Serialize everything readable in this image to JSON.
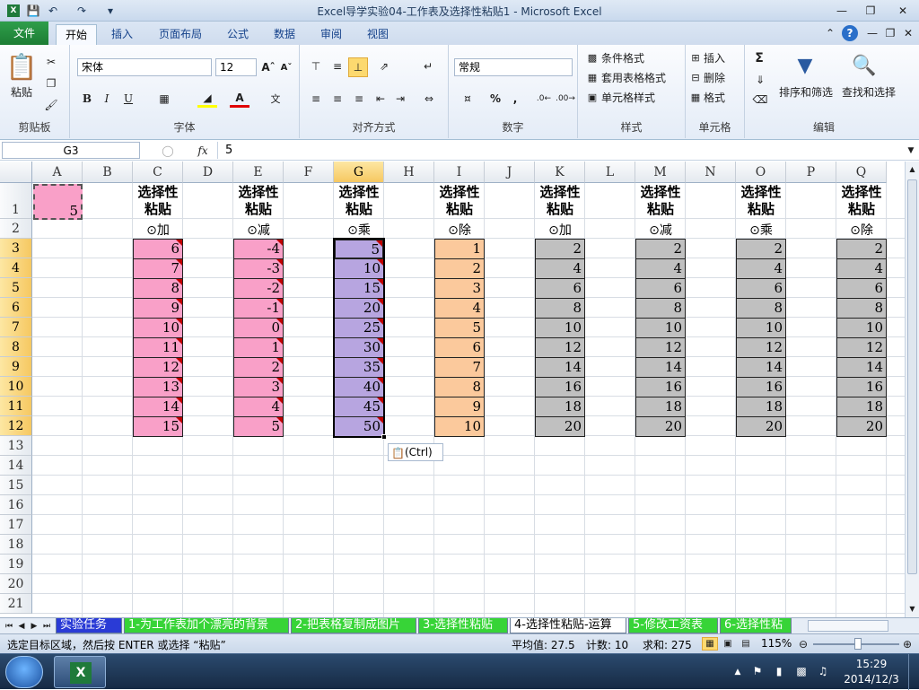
{
  "window": {
    "title": "Excel导学实验04-工作表及选择性粘贴1  -  Microsoft Excel"
  },
  "ribbon_tabs": [
    "文件",
    "开始",
    "插入",
    "页面布局",
    "公式",
    "数据",
    "审阅",
    "视图"
  ],
  "active_tab": "开始",
  "groups": {
    "clipboard": {
      "label": "剪贴板",
      "paste": "粘贴"
    },
    "font": {
      "label": "字体",
      "font_name": "宋体",
      "font_size": "12",
      "bold": "B",
      "italic": "I",
      "underline": "U"
    },
    "alignment": {
      "label": "对齐方式"
    },
    "number": {
      "label": "数字",
      "format": "常规",
      "percent": "%",
      "comma": ","
    },
    "styles": {
      "label": "样式",
      "conditional": "条件格式",
      "table": "套用表格格式",
      "cell_styles": "单元格样式"
    },
    "cells": {
      "label": "单元格",
      "insert": "插入",
      "delete": "删除",
      "format": "格式"
    },
    "editing": {
      "label": "编辑",
      "sort": "排序和筛选",
      "find": "查找和选择",
      "sigma": "Σ"
    }
  },
  "formula_bar": {
    "name_box": "G3",
    "fx": "fx",
    "value": "5"
  },
  "columns": [
    "A",
    "B",
    "C",
    "D",
    "E",
    "F",
    "G",
    "H",
    "I",
    "J",
    "K",
    "L",
    "M",
    "N",
    "O",
    "P",
    "Q"
  ],
  "selected_column": "G",
  "rows": [
    "1",
    "2",
    "3",
    "4",
    "5",
    "6",
    "7",
    "8",
    "9",
    "10",
    "11",
    "12",
    "13",
    "14",
    "15",
    "16",
    "17",
    "18",
    "19",
    "20",
    "21"
  ],
  "selected_rows": [
    "3",
    "4",
    "5",
    "6",
    "7",
    "8",
    "9",
    "10",
    "11",
    "12"
  ],
  "a1_value": "5",
  "header_title": "选择性粘贴",
  "blocks": [
    {
      "col": "C",
      "op": "⊙加",
      "values": [
        "6",
        "7",
        "8",
        "9",
        "10",
        "11",
        "12",
        "13",
        "14",
        "15"
      ],
      "color": "#f9a0c8",
      "marker": true
    },
    {
      "col": "E",
      "op": "⊙减",
      "values": [
        "-4",
        "-3",
        "-2",
        "-1",
        "0",
        "1",
        "2",
        "3",
        "4",
        "5"
      ],
      "color": "#f9a0c8",
      "marker": true
    },
    {
      "col": "G",
      "op": "⊙乘",
      "values": [
        "5",
        "10",
        "15",
        "20",
        "25",
        "30",
        "35",
        "40",
        "45",
        "50"
      ],
      "color": "#b7a5e0",
      "marker": true
    },
    {
      "col": "I",
      "op": "⊙除",
      "values": [
        "1",
        "2",
        "3",
        "4",
        "5",
        "6",
        "7",
        "8",
        "9",
        "10"
      ],
      "color": "#fbc99c",
      "marker": false
    },
    {
      "col": "K",
      "op": "⊙加",
      "values": [
        "2",
        "4",
        "6",
        "8",
        "10",
        "12",
        "14",
        "16",
        "18",
        "20"
      ],
      "color": "#c0c0c0",
      "marker": false
    },
    {
      "col": "M",
      "op": "⊙减",
      "values": [
        "2",
        "4",
        "6",
        "8",
        "10",
        "12",
        "14",
        "16",
        "18",
        "20"
      ],
      "color": "#c0c0c0",
      "marker": false
    },
    {
      "col": "O",
      "op": "⊙乘",
      "values": [
        "2",
        "4",
        "6",
        "8",
        "10",
        "12",
        "14",
        "16",
        "18",
        "20"
      ],
      "color": "#c0c0c0",
      "marker": false
    },
    {
      "col": "Q",
      "op": "⊙除",
      "values": [
        "2",
        "4",
        "6",
        "8",
        "10",
        "12",
        "14",
        "16",
        "18",
        "20"
      ],
      "color": "#c0c0c0",
      "marker": false
    }
  ],
  "paste_options": "(Ctrl)",
  "sheet_tabs": [
    {
      "label": "实验任务",
      "bg": "#2a3bd6",
      "fg": "#ffffff"
    },
    {
      "label": "1-为工作表加个漂亮的背景",
      "bg": "#37d437",
      "fg": "#ffffff"
    },
    {
      "label": "2-把表格复制成图片",
      "bg": "#37d437",
      "fg": "#ffffff"
    },
    {
      "label": "3-选择性粘贴",
      "bg": "#37d437",
      "fg": "#ffffff"
    },
    {
      "label": "4-选择性粘贴-运算",
      "bg": "#ffffff",
      "fg": "#000000"
    },
    {
      "label": "5-修改工资表",
      "bg": "#37d437",
      "fg": "#ffffff"
    },
    {
      "label": "6-选择性粘",
      "bg": "#37d437",
      "fg": "#ffffff"
    }
  ],
  "status": {
    "message": "选定目标区域，然后按 ENTER 或选择 “粘贴”",
    "average": "平均值: 27.5",
    "count": "计数: 10",
    "sum": "求和: 275",
    "zoom": "115%"
  },
  "taskbar": {
    "time": "15:29",
    "date": "2014/12/3"
  }
}
